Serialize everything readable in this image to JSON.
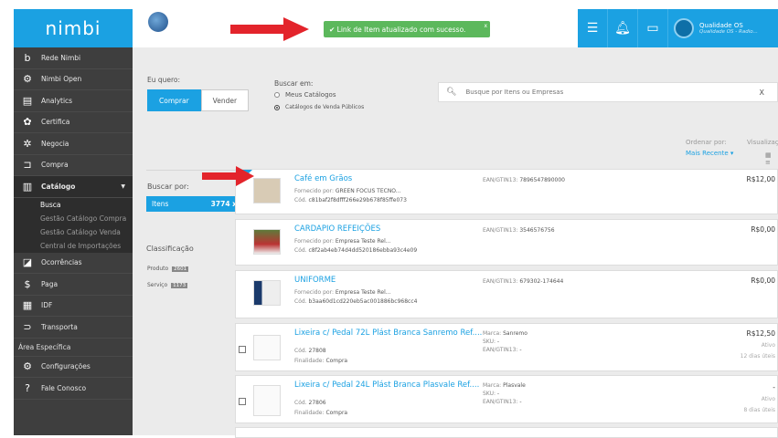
{
  "app": {
    "logo": "nimbi"
  },
  "sidebar": {
    "items": [
      {
        "label": "Rede Nimbi",
        "icon": "b-icon"
      },
      {
        "label": "Nimbi Open",
        "icon": "open-icon"
      },
      {
        "label": "Analytics",
        "icon": "chart-icon"
      },
      {
        "label": "Certifica",
        "icon": "certify-icon"
      },
      {
        "label": "Negocia",
        "icon": "handshake-icon"
      },
      {
        "label": "Compra",
        "icon": "cart-icon"
      },
      {
        "label": "Catálogo",
        "icon": "catalog-icon"
      }
    ],
    "sub": [
      "Busca",
      "Gestão Catálogo Compra",
      "Gestão Catálogo Venda",
      "Central de Importações"
    ],
    "items2": [
      {
        "label": "Ocorrências",
        "icon": "occurrence-icon"
      },
      {
        "label": "Paga",
        "icon": "dollar-icon"
      },
      {
        "label": "IDF",
        "icon": "idf-icon"
      },
      {
        "label": "Transporta",
        "icon": "truck-icon"
      }
    ],
    "section": "Área Específica",
    "items3": [
      {
        "label": "Configurações",
        "icon": "settings-icon"
      },
      {
        "label": "Fale Conosco",
        "icon": "help-icon"
      }
    ]
  },
  "topbar": {
    "toast": "Link de Item atualizado com sucesso.",
    "toast_close": "x",
    "user_name": "Qualidade OS",
    "user_sub": "Qualidade OS - Radio..."
  },
  "search": {
    "want_label": "Eu quero:",
    "buy": "Comprar",
    "sell": "Vender",
    "search_in": "Buscar em:",
    "opt1": "Meus Catálogos",
    "opt2": "Catálogos de Venda Públicos",
    "placeholder": "Busque por Itens ou Empresas",
    "clear": "X",
    "order_label": "Ordenar por:",
    "order_value": "Mais Recente",
    "view_label": "Visualizaç"
  },
  "filters": {
    "search_by": "Buscar por:",
    "itens": "Itens",
    "itens_count": "3774 x",
    "class_label": "Classificação",
    "produto": "Produto",
    "produto_count": "2601",
    "servico": "Serviço",
    "servico_count": "1173"
  },
  "results": [
    {
      "title": "Café em Grãos",
      "l1_label": "Fornecido por:",
      "l1": "GREEN FOCUS TECNO...",
      "l2_label": "Cód.",
      "l2": "c81baf2f8dfff266e29b678f85ffe073",
      "ean_label": "EAN/GTIN13:",
      "ean": "7896547890000",
      "price": "R$12,00"
    },
    {
      "title": "CARDAPIO REFEIÇÕES",
      "l1_label": "Fornecido por:",
      "l1": "Empresa Teste Rel...",
      "l2_label": "Cód.",
      "l2": "c8f2ab4eb74d4dd520186ebba93c4e09",
      "ean_label": "EAN/GTIN13:",
      "ean": "3546576756",
      "price": "R$0,00"
    },
    {
      "title": "UNIFORME",
      "l1_label": "Fornecido por:",
      "l1": "Empresa Teste Rel...",
      "l2_label": "Cód.",
      "l2": "b3aa60d1cd220eb5ac001886bc968cc4",
      "ean_label": "EAN/GTIN13:",
      "ean": "679302-174644",
      "price": "R$0,00"
    },
    {
      "title": "Lixeira c/ Pedal 72L Plást Branca Sanremo Ref....",
      "l1_label": "Cód.",
      "l1": "27808",
      "l2_label": "Finalidade:",
      "l2": "Compra",
      "marca_label": "Marca:",
      "marca": "Sanremo",
      "sku_label": "SKU:",
      "sku": "-",
      "ean_label": "EAN/GTIN13:",
      "ean": "-",
      "price": "R$12,50",
      "stat1": "Ativo",
      "stat2": "12 dias úteis"
    },
    {
      "title": "Lixeira c/ Pedal 24L Plást Branca Plasvale Ref....",
      "l1_label": "Cód.",
      "l1": "27806",
      "l2_label": "Finalidade:",
      "l2": "Compra",
      "marca_label": "Marca:",
      "marca": "Plasvale",
      "sku_label": "SKU:",
      "sku": "-",
      "ean_label": "EAN/GTIN13:",
      "ean": "-",
      "price": "-",
      "stat1": "Ativo",
      "stat2": "8 dias úteis"
    }
  ],
  "colors": {
    "accent": "#1ba1e2",
    "sidebar": "#3e3e3e",
    "toast": "#5cb85c",
    "arrow": "#e3242b"
  }
}
